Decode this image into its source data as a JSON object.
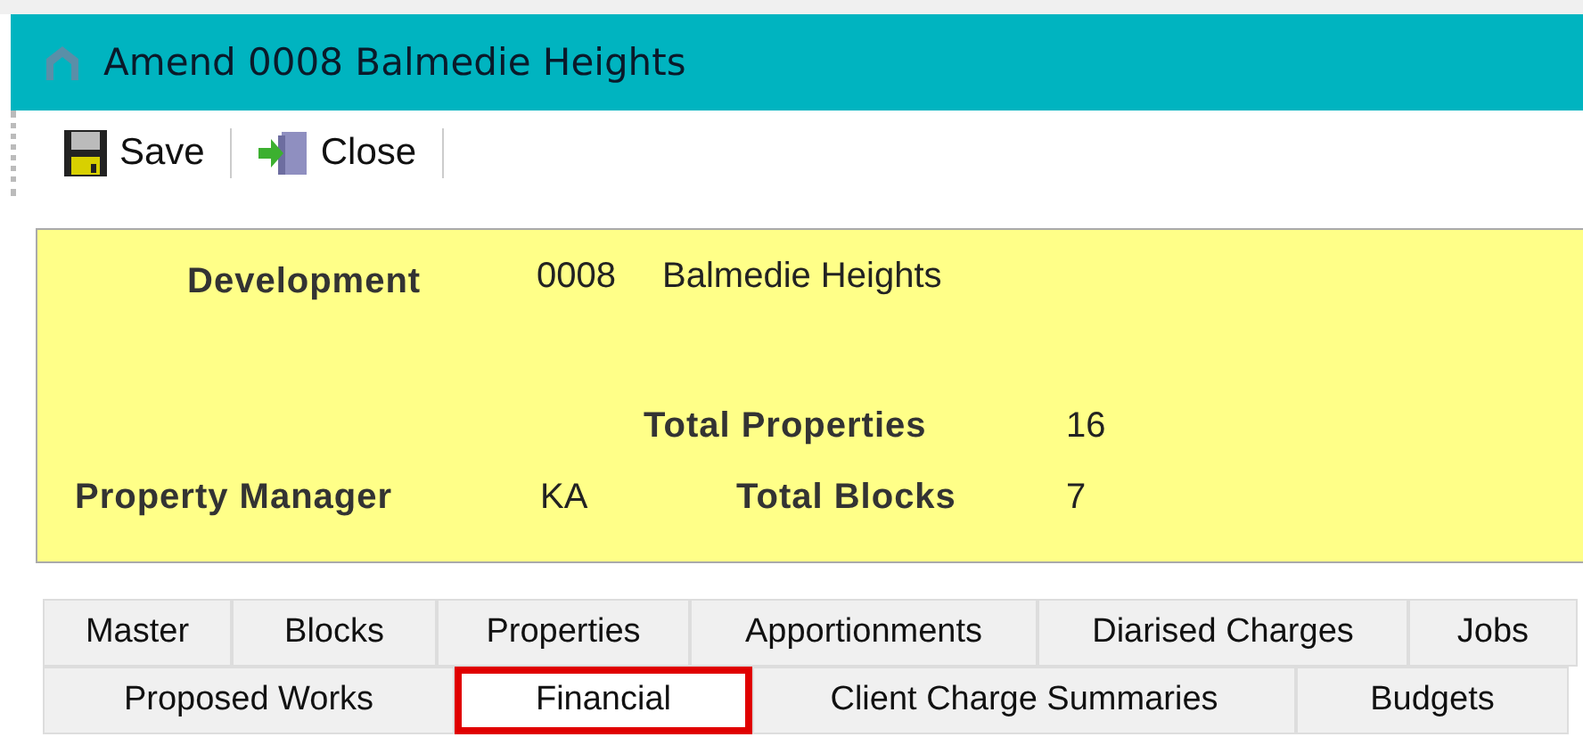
{
  "window": {
    "title": "Amend 0008 Balmedie Heights"
  },
  "toolbar": [
    {
      "kind": "save",
      "label": "Save"
    },
    {
      "kind": "close",
      "label": "Close"
    }
  ],
  "header": {
    "development_label": "Development",
    "development_code": "0008",
    "development_name": "Balmedie Heights",
    "total_properties_label": "Total Properties",
    "total_properties": "16",
    "property_manager_label": "Property Manager",
    "property_manager": "KA",
    "total_blocks_label": "Total Blocks",
    "total_blocks": "7"
  },
  "tab_rows": [
    [
      {
        "label": "Master",
        "selected": false
      },
      {
        "label": "Blocks",
        "selected": false
      },
      {
        "label": "Properties",
        "selected": false
      },
      {
        "label": "Apportionments",
        "selected": false
      },
      {
        "label": "Diarised Charges",
        "selected": false
      },
      {
        "label": "Jobs",
        "selected": false
      }
    ],
    [
      {
        "label": "Proposed Works",
        "selected": false
      },
      {
        "label": "Financial",
        "selected": true
      },
      {
        "label": "Client Charge Summaries",
        "selected": false
      },
      {
        "label": "Budgets",
        "selected": false
      }
    ]
  ]
}
